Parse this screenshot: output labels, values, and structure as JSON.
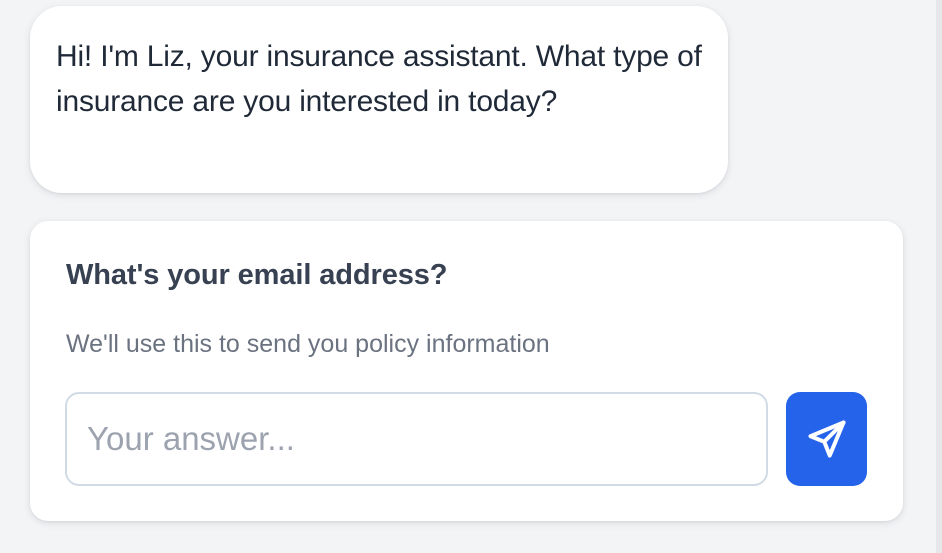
{
  "chat": {
    "assistant_message": "Hi! I'm Liz, your insurance assistant. What type of insurance are you interested in today?"
  },
  "question": {
    "title": "What's your email address?",
    "subtitle": "We'll use this to send you policy information",
    "input_value": "",
    "input_placeholder": "Your answer...",
    "send_icon": "send-icon"
  },
  "colors": {
    "page_background": "#f3f4f6",
    "card_background": "#ffffff",
    "accent": "#2563eb",
    "input_border": "#d1dbe6"
  }
}
